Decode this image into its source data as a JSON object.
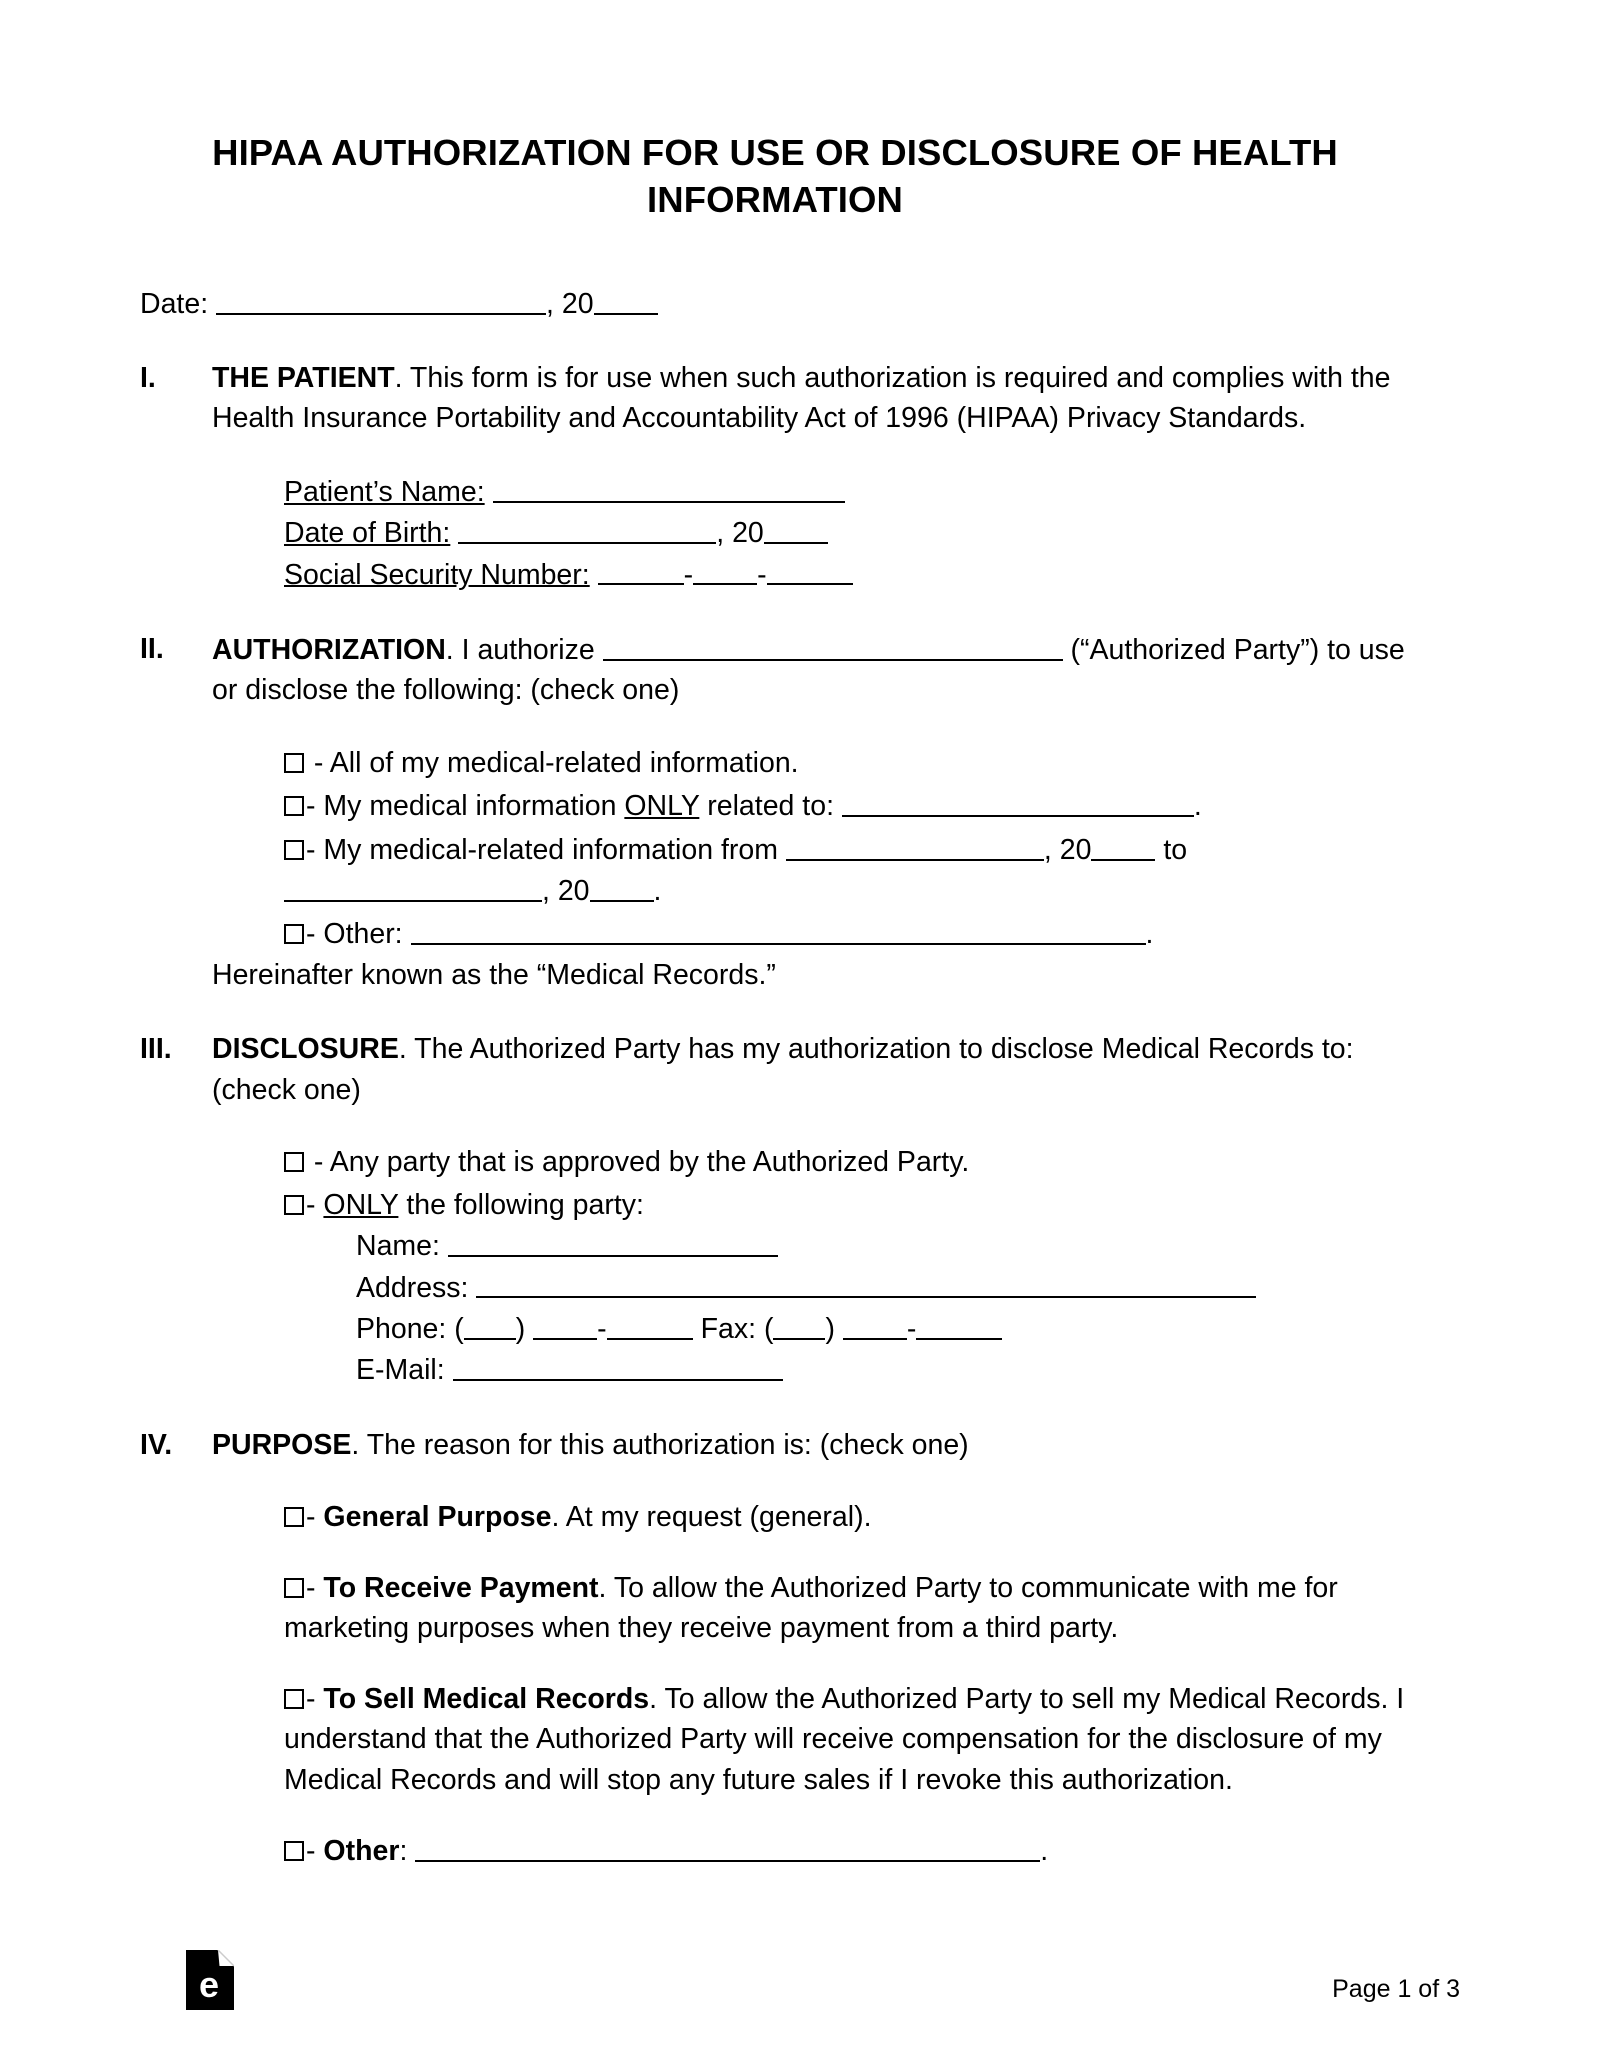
{
  "document": {
    "title": "HIPAA AUTHORIZATION FOR USE OR DISCLOSURE OF HEALTH INFORMATION",
    "date_label": "Date:",
    "date_year_prefix": ", 20"
  },
  "sections": {
    "one": {
      "numeral": "I.",
      "heading": "THE PATIENT",
      "body_1": ". This form is for use when such authorization is required and complies with the Health Insurance Portability and Accountability Act of 1996 (HIPAA) Privacy Standards.",
      "fields": {
        "patient_name_label": "Patient’s Name:",
        "dob_label": "Date of Birth:",
        "dob_year_prefix": ", 20",
        "ssn_label": "Social Security Number:",
        "ssn_sep": "-"
      }
    },
    "two": {
      "numeral": "II.",
      "heading": "AUTHORIZATION",
      "body_pre": ". I authorize ",
      "body_post": " (“Authorized Party”) to use or disclose the following: (check one)",
      "options": {
        "opt1": "- All of my medical-related information.",
        "opt2_pre": "- My medical information ",
        "opt2_only": "ONLY",
        "opt2_post": " related to: ",
        "opt2_end": ".",
        "opt3_pre": "- My medical-related information from ",
        "opt3_mid": ", 20",
        "opt3_to": " to ",
        "opt3_mid2": ", 20",
        "opt3_end": ".",
        "opt4_pre": "- Other: ",
        "opt4_end": "."
      },
      "hereinafter": "Hereinafter known as the “Medical Records.”"
    },
    "three": {
      "numeral": "III.",
      "heading": "DISCLOSURE",
      "body": ". The Authorized Party has my authorization to disclose Medical Records to: (check one)",
      "options": {
        "opt1": "- Any party that is approved by the Authorized Party.",
        "opt2_pre": "- ",
        "opt2_only": "ONLY",
        "opt2_post": " the following party:"
      },
      "party_fields": {
        "name_label": "Name:",
        "address_label": "Address:",
        "phone_label": "Phone: (",
        "phone_close": ") ",
        "phone_sep": "-",
        "fax_label": "Fax: (",
        "fax_close": ") ",
        "fax_sep": "-",
        "email_label": "E-Mail:"
      }
    },
    "four": {
      "numeral": "IV.",
      "heading": "PURPOSE",
      "body": ". The reason for this authorization is: (check one)",
      "options": {
        "opt1_dash": "- ",
        "opt1_bold": "General Purpose",
        "opt1_rest": ". At my request (general).",
        "opt2_dash": "- ",
        "opt2_bold": "To Receive Payment",
        "opt2_rest": ". To allow the Authorized Party to communicate with me for marketing purposes when they receive payment from a third party.",
        "opt3_dash": "- ",
        "opt3_bold": "To Sell Medical Records",
        "opt3_rest": ". To allow the Authorized Party to sell my Medical Records. I understand that the Authorized Party will receive compensation for the disclosure of my Medical Records and will stop any future sales if I revoke this authorization.",
        "opt4_dash": "- ",
        "opt4_bold": "Other",
        "opt4_rest": ": ",
        "opt4_end": "."
      }
    }
  },
  "footer": {
    "logo_letter": "e",
    "logo_name": "eforms-logo",
    "page_number": "Page 1 of 3"
  }
}
